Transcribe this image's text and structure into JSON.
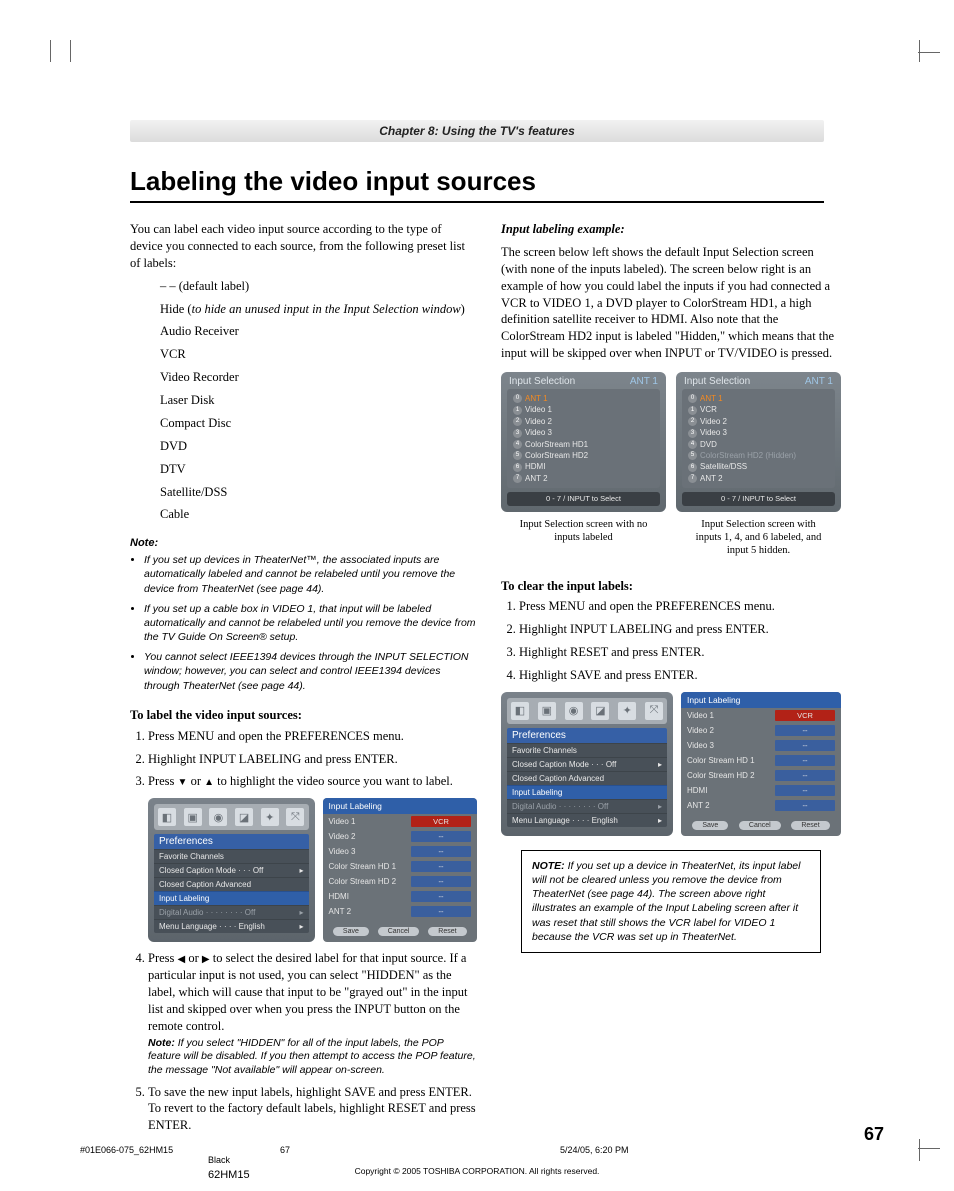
{
  "chapter": "Chapter 8: Using the TV's features",
  "title": "Labeling the video input sources",
  "intro": "You can label each video input source according to the type of device you connected to each source, from the following preset list of labels:",
  "labels": {
    "default": "– – (default label)",
    "hide_lead": "Hide (",
    "hide_ital": "to hide an unused input in the Input Selection window",
    "hide_tail": ")",
    "items": [
      "Audio Receiver",
      "VCR",
      "Video Recorder",
      "Laser Disk",
      "Compact Disc",
      "DVD",
      "DTV",
      "Satellite/DSS",
      "Cable"
    ]
  },
  "note_head": "Note:",
  "notes": [
    "If you set up devices in TheaterNet™, the associated inputs are automatically labeled and cannot be relabeled until you remove the device from TheaterNet (see page 44).",
    "If you set up a cable box in VIDEO 1, that input will be labeled automatically and cannot be relabeled until you remove the device from the TV Guide On Screen® setup.",
    "You cannot select IEEE1394 devices through the INPUT SELECTION window; however, you can select and control IEEE1394 devices through TheaterNet (see page 44)."
  ],
  "h_label": "To label the video input sources:",
  "steps": {
    "s1": "Press MENU and open the PREFERENCES menu.",
    "s2": "Highlight INPUT LABELING and press ENTER.",
    "s3a": "Press ",
    "s3b": " or ",
    "s3c": " to highlight the video source you want to label.",
    "s4a": "Press ",
    "s4b": " or ",
    "s4c": " to select the desired label for that input source. If a particular input is not used, you can select \"HIDDEN\" as the label, which will cause that input to be \"grayed out\" in the input list and skipped over when you press the INPUT button on the remote control.",
    "s4note_lead": "Note:",
    "s4note": " If you select \"HIDDEN\" for all of the input labels, the POP feature will be disabled. If you then attempt to access the POP feature, the message \"Not available\" will appear on-screen.",
    "s5": "To save the new input labels, highlight SAVE and press ENTER.",
    "s5b": "To revert to the factory default labels, highlight RESET and press ENTER."
  },
  "example_head": "Input labeling example:",
  "example": "The screen below left shows the default Input Selection screen (with none of the inputs labeled). The screen below right is an example of how you could label the inputs if you had connected a VCR to VIDEO 1, a DVD player to ColorStream HD1, a high definition satellite receiver to HDMI. Also note that the ColorStream HD2 input is labeled \"Hidden,\" which means that the input will be skipped over when INPUT or TV/VIDEO is pressed.",
  "osd_title": "Input Selection",
  "osd_ant": "ANT 1",
  "osd_left": [
    "ANT 1",
    "Video 1",
    "Video 2",
    "Video 3",
    "ColorStream HD1",
    "ColorStream HD2",
    "HDMI",
    "ANT 2"
  ],
  "osd_right": [
    "ANT 1",
    "VCR",
    "Video 2",
    "Video 3",
    "DVD",
    "ColorStream HD2 (Hidden)",
    "Satellite/DSS",
    "ANT 2"
  ],
  "osd_foot": "0 - 7 / INPUT to Select",
  "cap_left": "Input Selection screen with no inputs labeled",
  "cap_right": "Input Selection screen with inputs 1, 4, and 6 labeled, and input 5 hidden.",
  "h_clear": "To clear the input labels:",
  "clear_steps": [
    "Press MENU and open the PREFERENCES menu.",
    "Highlight INPUT LABELING and press ENTER.",
    "Highlight RESET and press ENTER.",
    "Highlight SAVE and press ENTER."
  ],
  "pref": {
    "title": "Preferences",
    "items": [
      {
        "l": "Favorite Channels",
        "r": ""
      },
      {
        "l": "Closed Caption Mode · · · Off",
        "r": "▸"
      },
      {
        "l": "Closed Caption Advanced",
        "r": ""
      },
      {
        "l": "Input Labeling",
        "r": ""
      },
      {
        "l": "Digital Audio · · · · · · · · Off",
        "r": "▸"
      },
      {
        "l": "Menu Language · · · · English",
        "r": "▸"
      }
    ]
  },
  "il": {
    "title": "Input Labeling",
    "rows": [
      {
        "n": "Video 1",
        "v": "VCR",
        "sel": true
      },
      {
        "n": "Video 2",
        "v": "--"
      },
      {
        "n": "Video 3",
        "v": "--"
      },
      {
        "n": "Color Stream HD 1",
        "v": "--"
      },
      {
        "n": "Color Stream HD 2",
        "v": "--"
      },
      {
        "n": "HDMI",
        "v": "--"
      },
      {
        "n": "ANT 2",
        "v": "--"
      }
    ],
    "btns": [
      "Save",
      "Cancel",
      "Reset"
    ]
  },
  "box_lead": "NOTE:",
  "box": " If you set up a device in TheaterNet, its input label will not be cleared unless you remove the device from TheaterNet (see page 44). The screen above right illustrates an example of the Input Labeling screen after it was reset that still shows the VCR label for VIDEO 1 because the VCR was set up in TheaterNet.",
  "copyright": "Copyright © 2005 TOSHIBA CORPORATION. All rights reserved.",
  "pagenum": "67",
  "footer": {
    "job": "#01E066-075_62HM15",
    "page": "67",
    "date": "5/24/05, 6:20 PM",
    "black": "Black",
    "model": "62HM15"
  }
}
